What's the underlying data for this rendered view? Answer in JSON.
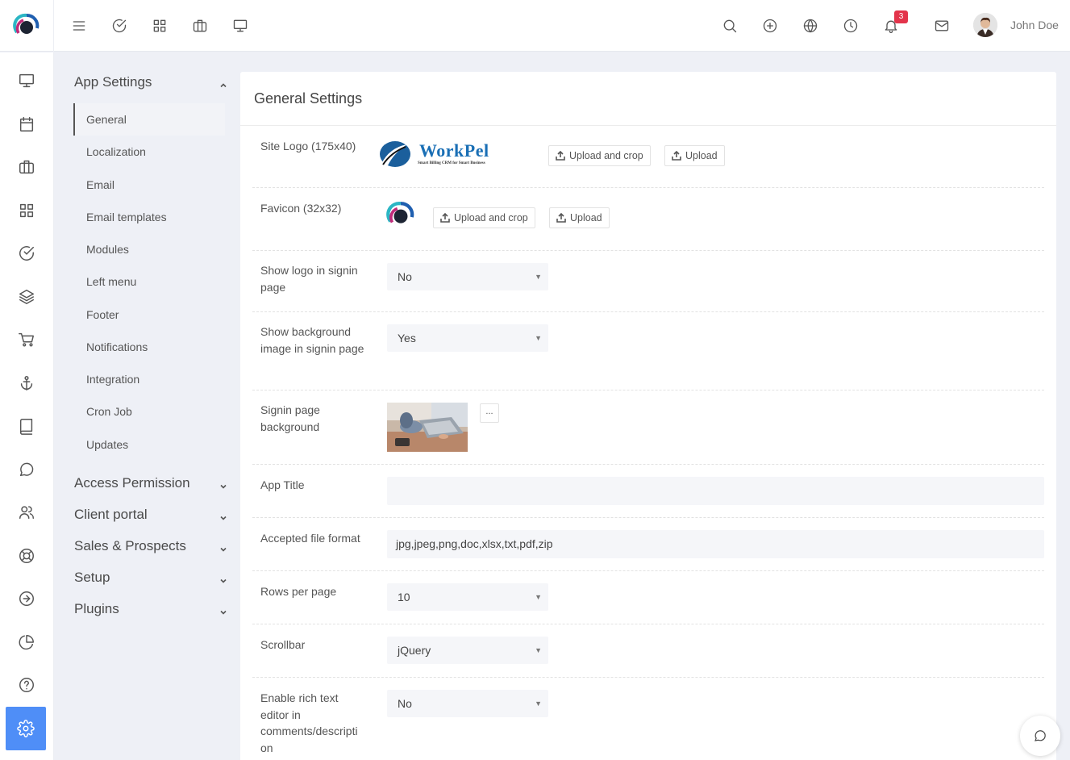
{
  "user": {
    "name": "John Doe",
    "notification_count": "3"
  },
  "topbar": {
    "left_icons": [
      "menu-icon",
      "check-circle-icon",
      "grid-icon",
      "briefcase-icon",
      "monitor-icon"
    ],
    "right_icons": [
      "search-icon",
      "plus-circle-icon",
      "globe-icon",
      "clock-icon",
      "bell-icon",
      "mail-icon"
    ]
  },
  "sidebar": {
    "icons": [
      "monitor-icon",
      "calendar-icon",
      "briefcase-icon",
      "grid-icon",
      "check-circle-icon",
      "layers-icon",
      "cart-icon",
      "anchor-icon",
      "book-icon",
      "chat-icon",
      "users-icon",
      "lifebuoy-icon",
      "arrow-circle-icon",
      "pie-chart-icon",
      "help-icon",
      "settings-icon"
    ],
    "active": "settings-icon"
  },
  "settings_menu": {
    "groups": [
      {
        "label": "App Settings",
        "expanded": true,
        "items": [
          "General",
          "Localization",
          "Email",
          "Email templates",
          "Modules",
          "Left menu",
          "Footer",
          "Notifications",
          "Integration",
          "Cron Job",
          "Updates"
        ],
        "active_item": "General"
      },
      {
        "label": "Access Permission",
        "expanded": false
      },
      {
        "label": "Client portal",
        "expanded": false
      },
      {
        "label": "Sales & Prospects",
        "expanded": false
      },
      {
        "label": "Setup",
        "expanded": false
      },
      {
        "label": "Plugins",
        "expanded": false
      }
    ]
  },
  "main": {
    "title": "General Settings",
    "site_logo": {
      "label": "Site Logo (175x40)",
      "logo_text": "WorkPel",
      "logo_tagline": "Smart Billing CRM for Smart Business",
      "upload_crop_label": "Upload and crop",
      "upload_label": "Upload"
    },
    "favicon": {
      "label": "Favicon (32x32)",
      "upload_crop_label": "Upload and crop",
      "upload_label": "Upload"
    },
    "show_logo_signin": {
      "label": "Show logo in signin page",
      "value": "No"
    },
    "show_bg_signin": {
      "label": "Show background image in signin page",
      "value": "Yes"
    },
    "signin_background": {
      "label": "Signin page background",
      "more_label": "..."
    },
    "app_title": {
      "label": "App Title",
      "value": ""
    },
    "accepted_file_format": {
      "label": "Accepted file format",
      "value": "jpg,jpeg,png,doc,xlsx,txt,pdf,zip"
    },
    "rows_per_page": {
      "label": "Rows per page",
      "value": "10"
    },
    "scrollbar": {
      "label": "Scrollbar",
      "value": "jQuery"
    },
    "rich_text": {
      "label": "Enable rich text editor in comments/description",
      "label_lines": [
        "Enable rich text",
        "editor in",
        "comments/descripti",
        "on"
      ],
      "value": "No"
    }
  },
  "colors": {
    "accent": "#4f8ef7",
    "badge": "#e3344b",
    "logo_blue": "#1a6fb5"
  }
}
